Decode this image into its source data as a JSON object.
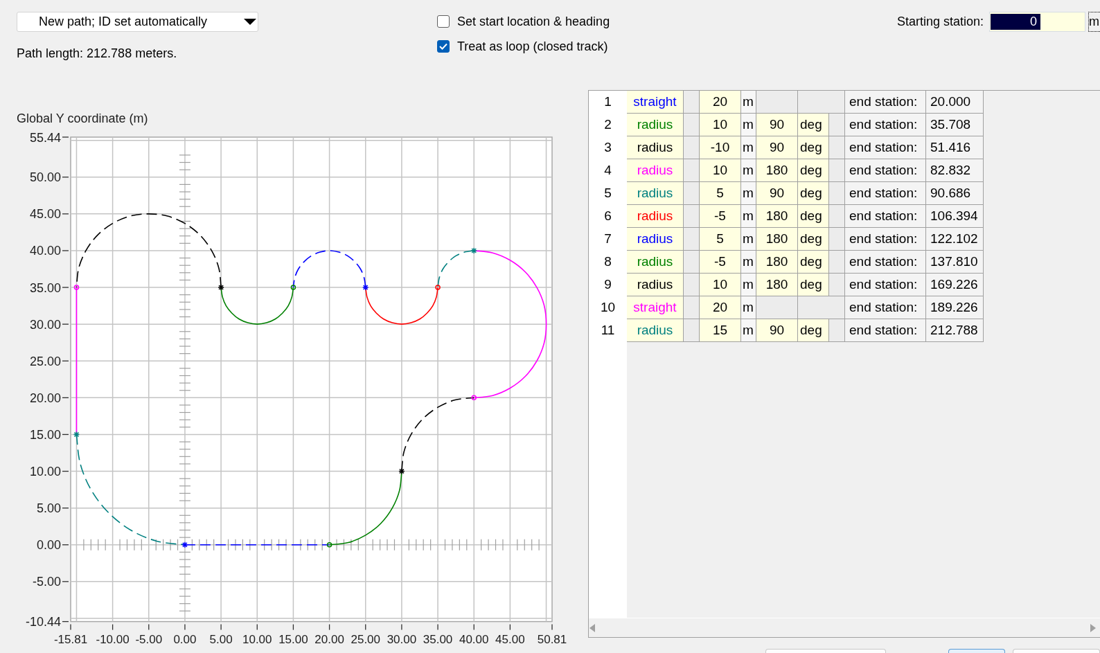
{
  "path_selector": {
    "value": "New path; ID set automatically"
  },
  "path_length": "Path length: 212.788 meters.",
  "options": [
    {
      "label": "Set start location & heading",
      "checked": false
    },
    {
      "label": "Treat as loop (closed track)",
      "checked": true
    }
  ],
  "starting_station": {
    "label": "Starting station:",
    "value": "0",
    "text_selected": true,
    "unit": "m",
    "unit_focused": true
  },
  "plot": {
    "chart_data": {
      "type": "line",
      "ylabel": "Global Y coordinate (m)",
      "grid": true,
      "xlim": [
        -15.81,
        50.81
      ],
      "ylim": [
        -10.44,
        55.44
      ],
      "xticks": [
        {
          "value": -15.81,
          "label": "-15.81"
        },
        {
          "value": -10,
          "label": "-10.00"
        },
        {
          "value": -5,
          "label": "-5.00"
        },
        {
          "value": 0,
          "label": "0.00"
        },
        {
          "value": 5,
          "label": "5.00"
        },
        {
          "value": 10,
          "label": "10.00"
        },
        {
          "value": 15,
          "label": "15.00"
        },
        {
          "value": 20,
          "label": "20.00"
        },
        {
          "value": 25,
          "label": "25.00"
        },
        {
          "value": 30,
          "label": "30.00"
        },
        {
          "value": 35,
          "label": "35.00"
        },
        {
          "value": 40,
          "label": "40.00"
        },
        {
          "value": 45,
          "label": "45.00"
        },
        {
          "value": 50.81,
          "label": "50.81"
        }
      ],
      "yticks": [
        {
          "value": 55.44,
          "label": "55.44"
        },
        {
          "value": 50,
          "label": "50.00"
        },
        {
          "value": 45,
          "label": "45.00"
        },
        {
          "value": 40,
          "label": "40.00"
        },
        {
          "value": 35,
          "label": "35.00"
        },
        {
          "value": 30,
          "label": "30.00"
        },
        {
          "value": 25,
          "label": "25.00"
        },
        {
          "value": 20,
          "label": "20.00"
        },
        {
          "value": 15,
          "label": "15.00"
        },
        {
          "value": 10,
          "label": "10.00"
        },
        {
          "value": 5,
          "label": "5.00"
        },
        {
          "value": 0,
          "label": "0.00"
        },
        {
          "value": -5,
          "label": "-5.00"
        },
        {
          "value": -10.44,
          "label": "-10.44"
        }
      ],
      "series": [
        {
          "color": "#0000ff",
          "line_style": "dashed",
          "x": [
            0,
            5,
            10,
            15,
            20
          ],
          "values": [
            0,
            0,
            0,
            0,
            0
          ]
        },
        {
          "color": "#008000",
          "line_style": "solid",
          "x": [
            20,
            22.6,
            25,
            27.1,
            28.7,
            29.7,
            30
          ],
          "values": [
            0,
            0.3,
            1.3,
            2.9,
            5,
            7.4,
            10
          ]
        },
        {
          "color": "#000000",
          "line_style": "dashed",
          "x": [
            30,
            30.3,
            31.3,
            32.9,
            35,
            37.4,
            40
          ],
          "values": [
            10,
            12.6,
            15,
            17.1,
            18.7,
            19.7,
            20
          ]
        },
        {
          "color": "#ff00ff",
          "line_style": "solid",
          "x": [
            40,
            42.6,
            45,
            47.1,
            48.7,
            49.7,
            50,
            49.7,
            48.7,
            47.1,
            45,
            42.6,
            40
          ],
          "values": [
            20,
            20.3,
            21.3,
            22.9,
            25,
            27.4,
            30,
            32.6,
            35,
            37.1,
            38.7,
            39.7,
            40
          ]
        },
        {
          "color": "#008080",
          "line_style": "dashed",
          "x": [
            40,
            38.7,
            37.5,
            36.5,
            35.7,
            35.2,
            35
          ],
          "values": [
            40,
            39.8,
            39.3,
            38.5,
            37.5,
            36.3,
            35
          ]
        },
        {
          "color": "#ff0000",
          "line_style": "solid",
          "x": [
            35,
            34.8,
            34.3,
            33.5,
            32.5,
            31.3,
            30,
            28.7,
            27.5,
            26.5,
            25.7,
            25.2,
            25
          ],
          "values": [
            35,
            33.7,
            32.5,
            31.5,
            30.7,
            30.2,
            30,
            30.2,
            30.7,
            31.5,
            32.5,
            33.7,
            35
          ]
        },
        {
          "color": "#0000ff",
          "line_style": "dashed",
          "x": [
            25,
            24.8,
            24.3,
            23.5,
            22.5,
            21.3,
            20,
            18.7,
            17.5,
            16.5,
            15.7,
            15.2,
            15
          ],
          "values": [
            35,
            36.3,
            37.5,
            38.5,
            39.3,
            39.8,
            40,
            39.8,
            39.3,
            38.5,
            37.5,
            36.3,
            35
          ]
        },
        {
          "color": "#008000",
          "line_style": "solid",
          "x": [
            15,
            14.8,
            14.3,
            13.5,
            12.5,
            11.3,
            10,
            8.7,
            7.5,
            6.5,
            5.7,
            5.2,
            5
          ],
          "values": [
            35,
            33.7,
            32.5,
            31.5,
            30.7,
            30.2,
            30,
            30.2,
            30.7,
            31.5,
            32.5,
            33.7,
            35
          ]
        },
        {
          "color": "#000000",
          "line_style": "dashed",
          "x": [
            5,
            4.7,
            3.7,
            2.1,
            0,
            -2.4,
            -5,
            -7.6,
            -10,
            -12.1,
            -13.7,
            -14.7,
            -15
          ],
          "values": [
            35,
            37.6,
            40,
            42.1,
            43.7,
            44.7,
            45,
            44.7,
            43.7,
            42.1,
            40,
            37.6,
            35
          ]
        },
        {
          "color": "#ff00ff",
          "line_style": "solid",
          "x": [
            -15,
            -15,
            -15,
            -15,
            -15
          ],
          "values": [
            35,
            30,
            25,
            20,
            15
          ]
        },
        {
          "color": "#008080",
          "line_style": "dashed",
          "x": [
            -15,
            -14.5,
            -13,
            -10.6,
            -7.5,
            -3.9,
            0
          ],
          "values": [
            15,
            11.1,
            7.5,
            4.4,
            2,
            0.5,
            0
          ]
        }
      ]
    }
  },
  "segments_table": {
    "rows": [
      {
        "number": "1",
        "type": "straight",
        "color": "#0000ff",
        "length": "20",
        "length_unit": "m",
        "end_label": "end station:",
        "end_value": "20.000"
      },
      {
        "number": "2",
        "type": "radius",
        "color": "#008000",
        "length": "10",
        "length_unit": "m",
        "angle": "90",
        "angle_unit": "deg",
        "end_label": "end station:",
        "end_value": "35.708"
      },
      {
        "number": "3",
        "type": "radius",
        "color": "#000000",
        "length": "-10",
        "length_unit": "m",
        "angle": "90",
        "angle_unit": "deg",
        "end_label": "end station:",
        "end_value": "51.416"
      },
      {
        "number": "4",
        "type": "radius",
        "color": "#ff00ff",
        "length": "10",
        "length_unit": "m",
        "angle": "180",
        "angle_unit": "deg",
        "end_label": "end station:",
        "end_value": "82.832"
      },
      {
        "number": "5",
        "type": "radius",
        "color": "#008080",
        "length": "5",
        "length_unit": "m",
        "angle": "90",
        "angle_unit": "deg",
        "end_label": "end station:",
        "end_value": "90.686"
      },
      {
        "number": "6",
        "type": "radius",
        "color": "#ff0000",
        "length": "-5",
        "length_unit": "m",
        "angle": "180",
        "angle_unit": "deg",
        "end_label": "end station:",
        "end_value": "106.394"
      },
      {
        "number": "7",
        "type": "radius",
        "color": "#0000ff",
        "length": "5",
        "length_unit": "m",
        "angle": "180",
        "angle_unit": "deg",
        "end_label": "end station:",
        "end_value": "122.102"
      },
      {
        "number": "8",
        "type": "radius",
        "color": "#008000",
        "length": "-5",
        "length_unit": "m",
        "angle": "180",
        "angle_unit": "deg",
        "end_label": "end station:",
        "end_value": "137.810"
      },
      {
        "number": "9",
        "type": "radius",
        "color": "#000000",
        "length": "10",
        "length_unit": "m",
        "angle": "180",
        "angle_unit": "deg",
        "end_label": "end station:",
        "end_value": "169.226"
      },
      {
        "number": "10",
        "type": "straight",
        "color": "#ff00ff",
        "length": "20",
        "length_unit": "m",
        "end_label": "end station:",
        "end_value": "189.226"
      },
      {
        "number": "11",
        "type": "radius",
        "color": "#008080",
        "length": "15",
        "length_unit": "m",
        "angle": "90",
        "angle_unit": "deg",
        "end_label": "end station:",
        "end_value": "212.788"
      }
    ]
  },
  "bottom_buttons": [
    {
      "focused": false
    },
    {
      "focused": true
    },
    {
      "focused": false
    }
  ]
}
